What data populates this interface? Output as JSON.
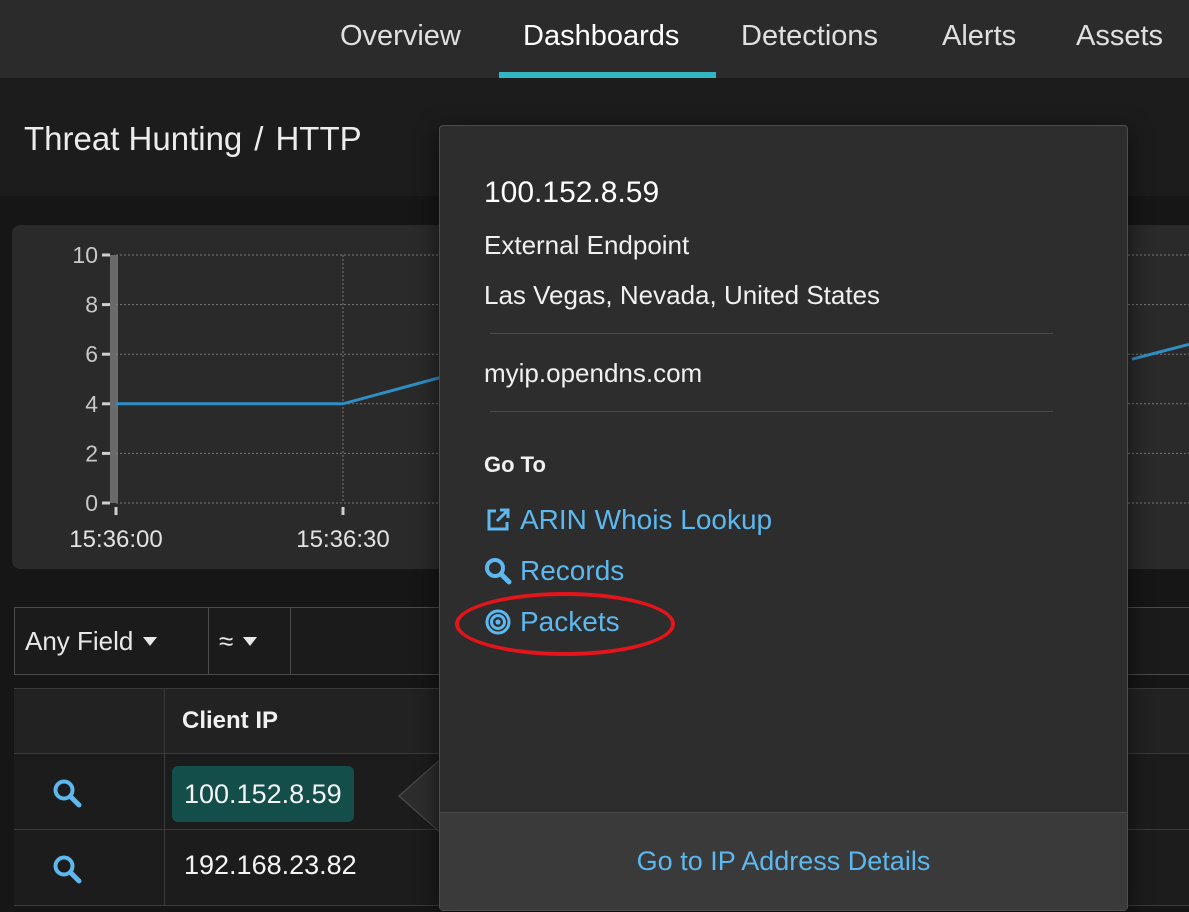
{
  "nav": {
    "tabs": [
      {
        "label": "Overview"
      },
      {
        "label": "Dashboards",
        "active": true
      },
      {
        "label": "Detections"
      },
      {
        "label": "Alerts"
      },
      {
        "label": "Assets"
      }
    ],
    "accent_color": "#33b6c2"
  },
  "header": {
    "breadcrumb_parent": "Threat Hunting",
    "separator": "/",
    "breadcrumb_current": "HTTP"
  },
  "chart_data": {
    "type": "line",
    "x_tick_labels": [
      "15:36:00",
      "15:36:30"
    ],
    "y_ticks": [
      0,
      2,
      4,
      6,
      8,
      10
    ],
    "ylim": [
      0,
      10
    ],
    "grid": true,
    "series": [
      {
        "color": "#2f8fc4",
        "points": [
          {
            "x": "15:36:00",
            "y": 4
          },
          {
            "x": "15:36:30",
            "y": 4
          }
        ]
      }
    ]
  },
  "filter": {
    "field_label": "Any Field",
    "operator_label": "≈"
  },
  "table": {
    "columns": [
      "Client IP"
    ],
    "rows": [
      {
        "client_ip": "100.152.8.59",
        "selected": true
      },
      {
        "client_ip": "192.168.23.82"
      }
    ]
  },
  "popover": {
    "ip": "100.152.8.59",
    "endpoint_type": "External Endpoint",
    "location": "Las Vegas, Nevada, United States",
    "hostname": "myip.opendns.com",
    "goto_heading": "Go To",
    "links": [
      {
        "label": "ARIN Whois Lookup",
        "icon": "external-link-icon"
      },
      {
        "label": "Records",
        "icon": "search-icon"
      },
      {
        "label": "Packets",
        "icon": "packets-icon",
        "highlighted": true
      }
    ],
    "footer_link": "Go to IP Address Details",
    "link_color": "#5cb8ee",
    "highlight_color": "#e2151a"
  }
}
